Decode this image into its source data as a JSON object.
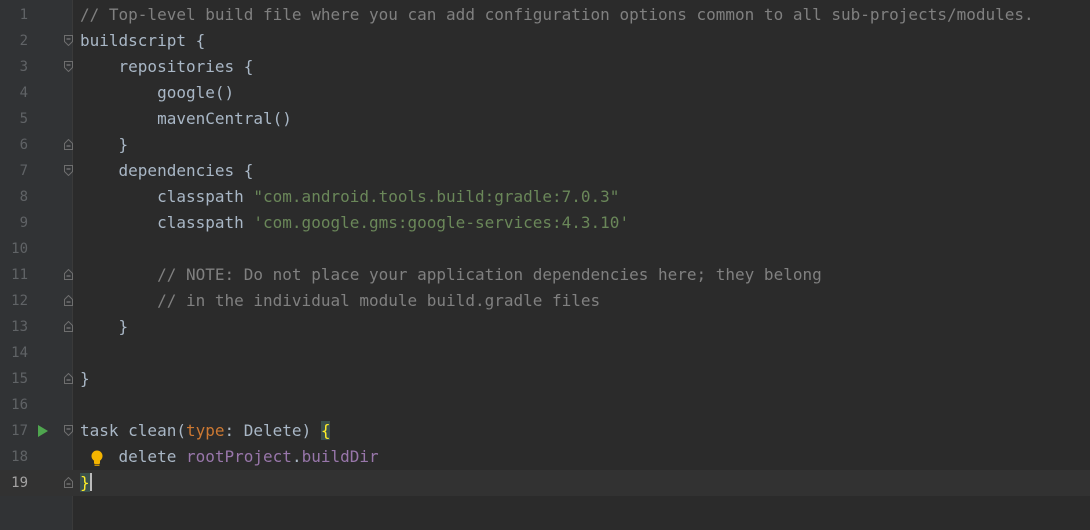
{
  "editor": {
    "lines": [
      {
        "num": "1",
        "indent": "",
        "parts": [
          {
            "t": "// Top-level build file where you can add configuration options common to all sub-projects/modules.",
            "c": "cm"
          }
        ]
      },
      {
        "num": "2",
        "indent": "",
        "parts": [
          {
            "t": "buildscript {",
            "c": ""
          }
        ]
      },
      {
        "num": "3",
        "indent": "    ",
        "parts": [
          {
            "t": "repositories {",
            "c": ""
          }
        ]
      },
      {
        "num": "4",
        "indent": "        ",
        "parts": [
          {
            "t": "google()",
            "c": ""
          }
        ]
      },
      {
        "num": "5",
        "indent": "        ",
        "parts": [
          {
            "t": "mavenCentral()",
            "c": ""
          }
        ]
      },
      {
        "num": "6",
        "indent": "    ",
        "parts": [
          {
            "t": "}",
            "c": ""
          }
        ]
      },
      {
        "num": "7",
        "indent": "    ",
        "parts": [
          {
            "t": "dependencies {",
            "c": ""
          }
        ]
      },
      {
        "num": "8",
        "indent": "        ",
        "parts": [
          {
            "t": "classpath ",
            "c": ""
          },
          {
            "t": "\"com.android.tools.build:gradle:7.0.3\"",
            "c": "str"
          }
        ]
      },
      {
        "num": "9",
        "indent": "        ",
        "parts": [
          {
            "t": "classpath ",
            "c": ""
          },
          {
            "t": "'com.google.gms:google-services:4.3.10'",
            "c": "str"
          }
        ]
      },
      {
        "num": "10",
        "indent": "",
        "parts": []
      },
      {
        "num": "11",
        "indent": "        ",
        "parts": [
          {
            "t": "// NOTE: Do not place your application dependencies here; they belong",
            "c": "cm"
          }
        ]
      },
      {
        "num": "12",
        "indent": "        ",
        "parts": [
          {
            "t": "// in the individual module build.gradle files",
            "c": "cm"
          }
        ]
      },
      {
        "num": "13",
        "indent": "    ",
        "parts": [
          {
            "t": "}",
            "c": ""
          }
        ]
      },
      {
        "num": "14",
        "indent": "",
        "parts": []
      },
      {
        "num": "15",
        "indent": "",
        "parts": [
          {
            "t": "}",
            "c": ""
          }
        ]
      },
      {
        "num": "16",
        "indent": "",
        "parts": []
      },
      {
        "num": "17",
        "indent": "",
        "parts": [
          {
            "t": "task clean(",
            "c": ""
          },
          {
            "t": "type",
            "c": "kw"
          },
          {
            "t": ": Delete) ",
            "c": ""
          },
          {
            "t": "{",
            "c": "brace-hl"
          }
        ]
      },
      {
        "num": "18",
        "indent": "    ",
        "parts": [
          {
            "t": "delete ",
            "c": ""
          },
          {
            "t": "rootProject",
            "c": "prop"
          },
          {
            "t": ".",
            "c": ""
          },
          {
            "t": "buildDir",
            "c": "prop"
          }
        ]
      },
      {
        "num": "19",
        "indent": "",
        "parts": [
          {
            "t": "}",
            "c": "brace-hl"
          }
        ]
      }
    ],
    "fold_open_lines": [
      "2",
      "3",
      "7",
      "17"
    ],
    "fold_close_lines": [
      "6",
      "11",
      "12",
      "13",
      "15",
      "19"
    ],
    "run_gutter_line": "17",
    "intention_bulb_line": "18",
    "current_line": "19",
    "colors": {
      "background": "#2b2b2b",
      "gutter": "#313335",
      "comment": "#808080",
      "string": "#6a8759",
      "keyword": "#cc7832",
      "property": "#9876aa",
      "text": "#a9b7c6",
      "brace_match": "#ffef28",
      "run_icon": "#4fa64f"
    }
  }
}
